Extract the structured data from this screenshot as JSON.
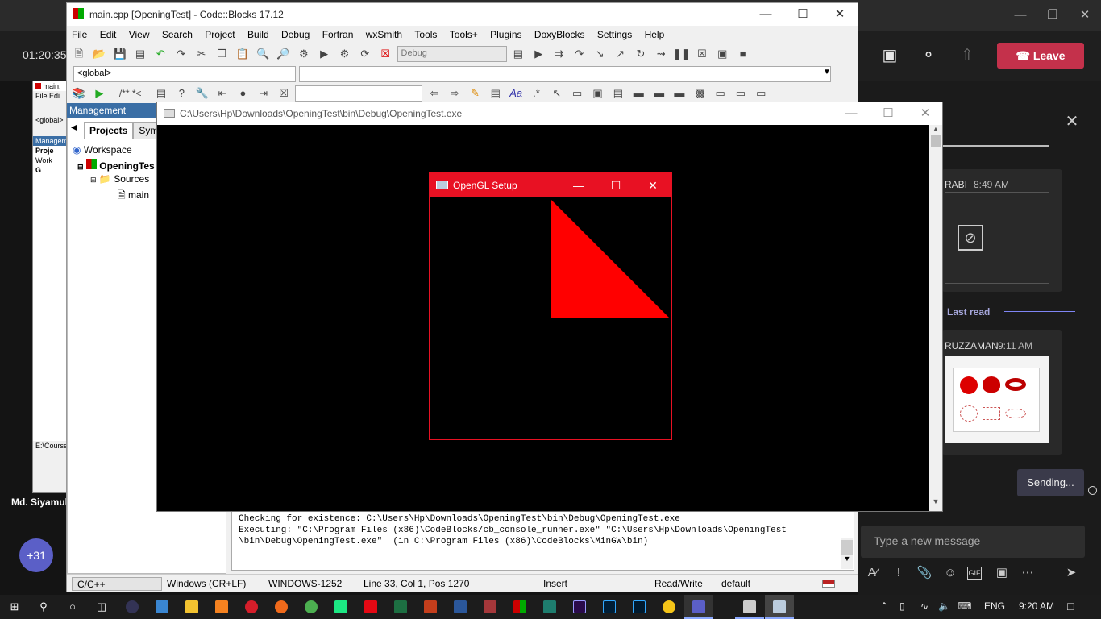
{
  "teams": {
    "call_timer": "01:20:35",
    "leave_label": "Leave",
    "participant_name": "Md. Siyamul",
    "more_participants": "+31",
    "chat": {
      "msg1_sender": "RABI",
      "msg1_time": "8:49 AM",
      "last_read": "Last read",
      "msg2_sender": "RUZZAMAN",
      "msg2_time": "9:11 AM",
      "sending": "Sending...",
      "compose_placeholder": "Type a new message"
    }
  },
  "codeblocks": {
    "title": "main.cpp [OpeningTest] - Code::Blocks 17.12",
    "menu": [
      "File",
      "Edit",
      "View",
      "Search",
      "Project",
      "Build",
      "Debug",
      "Fortran",
      "wxSmith",
      "Tools",
      "Tools+",
      "Plugins",
      "DoxyBlocks",
      "Settings",
      "Help"
    ],
    "build_target": "Debug",
    "scope": "<global>",
    "management_title": "Management",
    "tabs": {
      "projects": "Projects",
      "symbols": "Symb"
    },
    "tree": {
      "workspace": "Workspace",
      "project": "OpeningTes",
      "sources": "Sources",
      "file": "main"
    },
    "log_lines": [
      "Checking for existence: C:\\Users\\Hp\\Downloads\\OpeningTest\\bin\\Debug\\OpeningTest.exe",
      "Executing: \"C:\\Program Files (x86)\\CodeBlocks/cb_console_runner.exe\" \"C:\\Users\\Hp\\Downloads\\OpeningTest",
      "\\bin\\Debug\\OpeningTest.exe\"  (in C:\\Program Files (x86)\\CodeBlocks\\MinGW\\bin)"
    ],
    "status": {
      "language": "C/C++",
      "line_endings": "Windows (CR+LF)",
      "encoding": "WINDOWS-1252",
      "position": "Line 33, Col 1, Pos 1270",
      "mode": "Insert",
      "access": "Read/Write",
      "profile": "default"
    },
    "bg_window": {
      "title": "main.",
      "file_menu": "File",
      "edit_menu": "Edi",
      "scope": "<global>",
      "management": "Manageme",
      "projects_tab": "Proje",
      "workspace": "Work",
      "project": "G",
      "path": "E:\\Course"
    }
  },
  "console": {
    "title": "C:\\Users\\Hp\\Downloads\\OpeningTest\\bin\\Debug\\OpeningTest.exe"
  },
  "opengl": {
    "title": "OpenGL Setup",
    "triangle_color": "#ff0000"
  },
  "taskbar": {
    "language": "ENG",
    "time": "9:20 AM"
  },
  "colors": {
    "teams_leave": "#c4314b",
    "teams_accent": "#5b5fc7",
    "opengl_titlebar": "#e81123"
  }
}
